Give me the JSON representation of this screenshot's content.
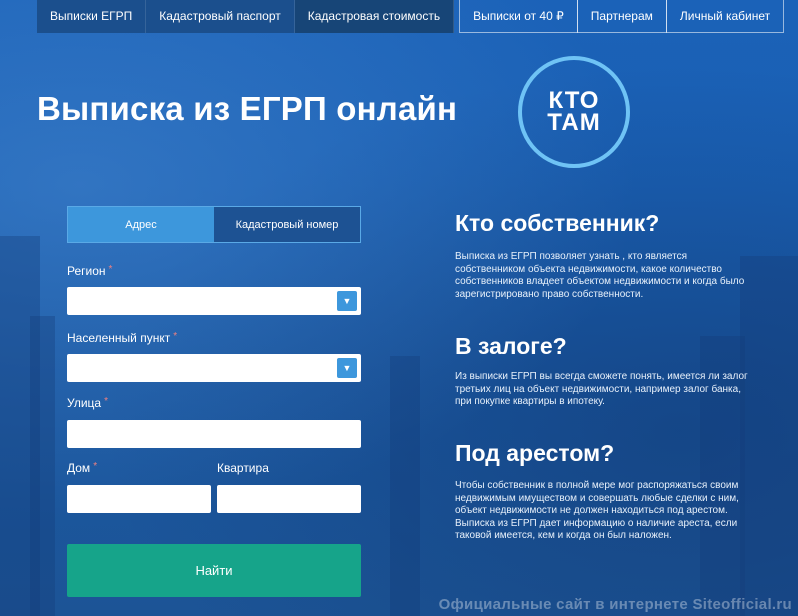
{
  "nav": {
    "left": [
      "Выписки ЕГРП",
      "Кадастровый паспорт",
      "Кадастровая стоимость"
    ],
    "right": [
      "Выписки от 40 ₽",
      "Партнерам",
      "Личный кабинет"
    ]
  },
  "title": "Выписка из ЕГРП онлайн",
  "logo": {
    "line1": "КТО",
    "line2": "ТАМ"
  },
  "form": {
    "tabs": [
      "Адрес",
      "Кадастровый номер"
    ],
    "region_label": "Регион",
    "city_label": "Населенный пункт",
    "street_label": "Улица",
    "house_label": "Дом",
    "apartment_label": "Квартира",
    "required_mark": "*",
    "submit_label": "Найти"
  },
  "sections": [
    {
      "heading": "Кто собственник?",
      "text": "Выписка из ЕГРП позволяет узнать , кто является собственником объекта недвижимости, какое количество собственников владеет объектом недвижимости и когда было зарегистрировано право собственности."
    },
    {
      "heading": "В залоге?",
      "text": "Из выписки ЕГРП вы всегда сможете понять, имеется ли залог третьих лиц на объект недвижимости, например залог банка, при покупке квартиры в ипотеку."
    },
    {
      "heading": "Под арестом?",
      "text": "Чтобы собственник в полной мере мог распоряжаться своим недвижимым имуществом и совершать любые сделки с ним, объект недвижимости не должен находиться под арестом. Выписка из ЕГРП дает информацию о наличие ареста, если таковой имеется, кем и когда он был наложен."
    }
  ],
  "watermark": "Официальные сайт в интернете Siteofficial.ru",
  "colors": {
    "accent": "#3d97dc",
    "submit": "#16a48a",
    "background": "#1a5fb2"
  }
}
